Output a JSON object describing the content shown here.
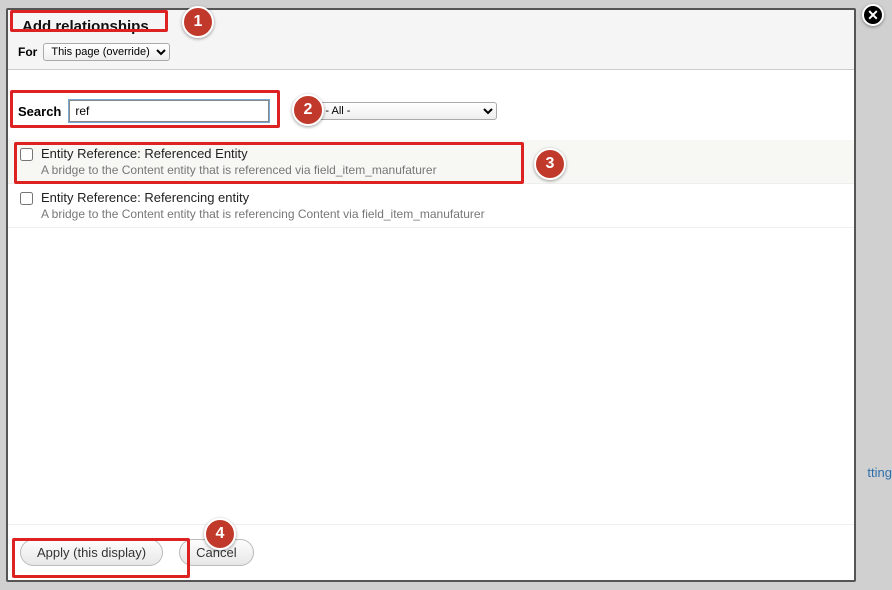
{
  "modal": {
    "title": "Add relationships",
    "close_icon": "✕",
    "for_label": "For",
    "for_options": [
      "This page (override)"
    ],
    "for_selected": "This page (override)"
  },
  "search": {
    "label": "Search",
    "value": "ref",
    "filter_options": [
      "- All -"
    ],
    "filter_selected": "- All -"
  },
  "results": [
    {
      "title": "Entity Reference: Referenced Entity",
      "desc": "A bridge to the Content entity that is referenced via field_item_manufaturer"
    },
    {
      "title": "Entity Reference: Referencing entity",
      "desc": "A bridge to the Content entity that is referencing Content via field_item_manufaturer"
    }
  ],
  "footer": {
    "apply_label": "Apply (this display)",
    "cancel_label": "Cancel"
  },
  "annotations": [
    "1",
    "2",
    "3",
    "4"
  ],
  "background_hint": "tting"
}
